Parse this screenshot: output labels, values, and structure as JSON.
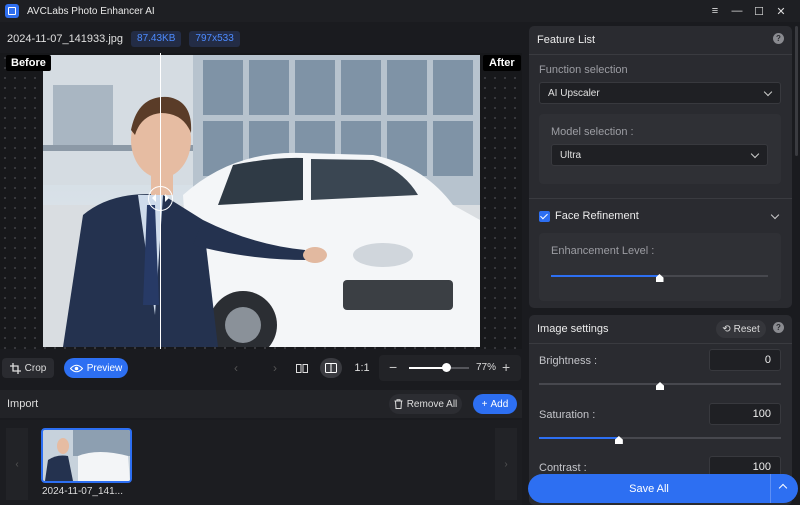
{
  "app": {
    "title": "AVCLabs Photo Enhancer AI"
  },
  "window_controls": {
    "menu": "≡",
    "minimize": "—",
    "maximize": "☐",
    "close": "✕"
  },
  "file": {
    "name": "2024-11-07_141933.jpg",
    "size": "87.43KB",
    "resolution": "797x533"
  },
  "viewer": {
    "before_label": "Before",
    "after_label": "After"
  },
  "toolbar": {
    "crop_label": "Crop",
    "preview_label": "Preview",
    "ratio_label": "1:1",
    "zoom_value": "77%",
    "zoom_fraction": 0.77
  },
  "import": {
    "label": "Import",
    "remove_all_label": "Remove All",
    "add_label": "Add",
    "thumbnails": [
      {
        "name": "2024-11-07_141..."
      }
    ]
  },
  "feature_list": {
    "title": "Feature List",
    "function_label": "Function selection",
    "function_value": "AI Upscaler",
    "model_label": "Model selection :",
    "model_value": "Ultra",
    "face_refinement_label": "Face Refinement",
    "face_refinement_checked": true,
    "enhancement_label": "Enhancement Level :",
    "enhancement_fraction": 0.5
  },
  "image_settings": {
    "title": "Image settings",
    "reset_label": "Reset",
    "rows": [
      {
        "label": "Brightness :",
        "value": "0",
        "fraction": 0.5
      },
      {
        "label": "Saturation :",
        "value": "100",
        "fraction": 0.33
      },
      {
        "label": "Contrast :",
        "value": "100"
      }
    ]
  },
  "save": {
    "label": "Save All"
  },
  "colors": {
    "accent": "#2d6ff2",
    "panel": "#2a2b30",
    "background": "#1a1b1f"
  }
}
